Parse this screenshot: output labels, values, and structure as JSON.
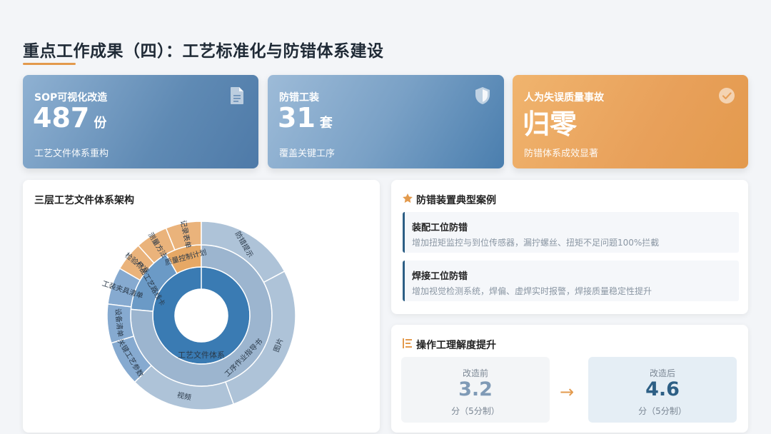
{
  "page": {
    "title": "重点工作成果（四）：工艺标准化与防错体系建设"
  },
  "kpis": [
    {
      "label": "SOP可视化改造",
      "value": "487",
      "unit": "份",
      "sub": "工艺文件体系重构",
      "icon": "document-icon"
    },
    {
      "label": "防错工装",
      "value": "31",
      "unit": "套",
      "sub": "覆盖关键工序",
      "icon": "shield-icon"
    },
    {
      "label": "人为失误质量事故",
      "value": "归零",
      "unit": "",
      "sub": "防错体系成效显著",
      "icon": "check-circle-icon"
    }
  ],
  "architecture": {
    "title": "三层工艺文件体系架构",
    "center_label": "工艺文件体系",
    "level2": [
      {
        "label": "产品工艺路线卡",
        "color": "#6b9ac6"
      },
      {
        "label": "质量控制计划",
        "color": "#e6a865"
      },
      {
        "label": "工序作业指导书",
        "color": "#9cb5cf"
      }
    ],
    "level3": [
      {
        "label": "工装夹具清单",
        "color": "#86aad0"
      },
      {
        "label": "检验标准",
        "color": "#eab37b"
      },
      {
        "label": "测量方法",
        "color": "#eab37b"
      },
      {
        "label": "记录表单",
        "color": "#eab37b"
      },
      {
        "label": "防错提示",
        "color": "#aec3d8"
      },
      {
        "label": "图片",
        "color": "#aec3d8"
      },
      {
        "label": "视频",
        "color": "#aec3d8"
      },
      {
        "label": "关键工艺参数",
        "color": "#86aad0"
      },
      {
        "label": "设备清单",
        "color": "#86aad0"
      }
    ]
  },
  "cases": {
    "title": "防错装置典型案例",
    "items": [
      {
        "title": "装配工位防错",
        "desc": "增加扭矩监控与到位传感器，漏拧螺丝、扭矩不足问题100%拦截"
      },
      {
        "title": "焊接工位防错",
        "desc": "增加视觉检测系统，焊偏、虚焊实时报警，焊接质量稳定性提升"
      }
    ]
  },
  "score": {
    "title": "操作工理解度提升",
    "before": {
      "label": "改造前",
      "value": "3.2",
      "unit": "分（5分制）"
    },
    "after": {
      "label": "改造后",
      "value": "4.6",
      "unit": "分（5分制）"
    },
    "arrow": "→"
  },
  "colors": {
    "accent": "#e39a4d",
    "primary": "#2d5f85",
    "core": "#3a7bb3"
  }
}
